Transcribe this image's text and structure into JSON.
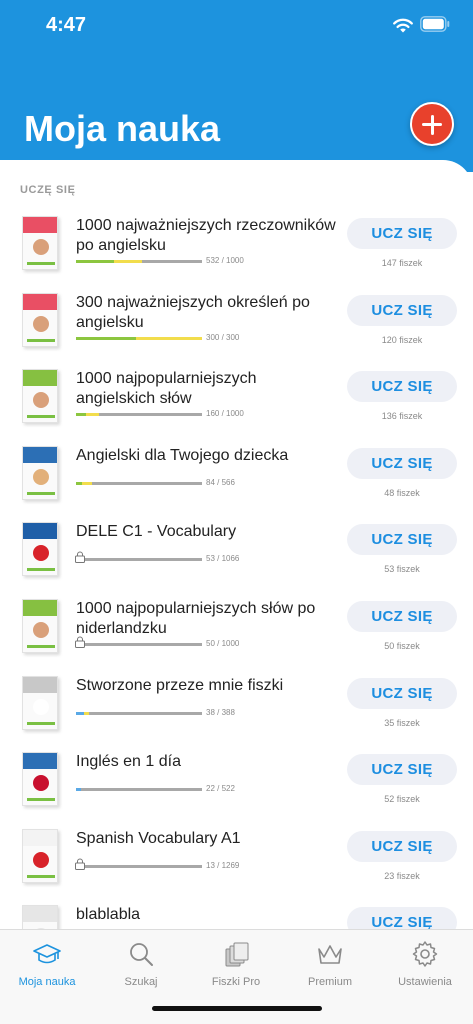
{
  "status": {
    "time": "4:47"
  },
  "header": {
    "title": "Moja nauka",
    "add_icon": "plus-icon"
  },
  "section": {
    "label": "UCZĘ SIĘ"
  },
  "colors": {
    "accent": "#1d93de",
    "add_button": "#e8412c",
    "progress_green": "#8cc63f",
    "progress_yellow": "#f2dd4c",
    "progress_blue": "#5aa9e6"
  },
  "courses": [
    {
      "title": "1000 najważniejszych rzeczowników po angielsku",
      "count": "532 / 1000",
      "fiszki": "147 fiszek",
      "button": "UCZ SIĘ",
      "green": 0.3,
      "yellow": 0.22,
      "blue": 0,
      "locked": false,
      "cover_color": "#e94f64",
      "face_color": "#d9a07a"
    },
    {
      "title": "300 najważniejszych określeń po angielsku",
      "count": "300 / 300",
      "fiszki": "120 fiszek",
      "button": "UCZ SIĘ",
      "green": 0.48,
      "yellow": 0.52,
      "blue": 0,
      "locked": false,
      "cover_color": "#e94f64",
      "face_color": "#d9a07a"
    },
    {
      "title": "1000 najpopularniejszych angielskich słów",
      "count": "160 / 1000",
      "fiszki": "136 fiszek",
      "button": "UCZ SIĘ",
      "green": 0.08,
      "yellow": 0.1,
      "blue": 0,
      "locked": false,
      "cover_color": "#86c041",
      "face_color": "#d9a07a"
    },
    {
      "title": "Angielski dla Twojego dziecka",
      "count": "84 / 566",
      "fiszki": "48 fiszek",
      "button": "UCZ SIĘ",
      "green": 0.05,
      "yellow": 0.08,
      "blue": 0,
      "locked": false,
      "cover_color": "#2c6fb5",
      "face_color": "#e2b07a"
    },
    {
      "title": "DELE C1 - Vocabulary",
      "count": "53 / 1066",
      "fiszki": "53 fiszek",
      "button": "UCZ SIĘ",
      "green": 0,
      "yellow": 0,
      "blue": 0,
      "locked": true,
      "cover_color": "#1f5fa8",
      "face_color": "#d8232a"
    },
    {
      "title": "1000 najpopularniejszych słów po niderlandzku",
      "count": "50 / 1000",
      "fiszki": "50 fiszek",
      "button": "UCZ SIĘ",
      "green": 0,
      "yellow": 0,
      "blue": 0,
      "locked": true,
      "cover_color": "#86c041",
      "face_color": "#d9a07a"
    },
    {
      "title": "Stworzone przeze mnie fiszki",
      "count": "38 / 388",
      "fiszki": "35 fiszek",
      "button": "UCZ SIĘ",
      "green": 0,
      "yellow": 0.04,
      "blue": 0.06,
      "locked": false,
      "cover_color": "#c8c8c8",
      "face_color": "#ffffff"
    },
    {
      "title": "Inglés en 1 día",
      "count": "22 / 522",
      "fiszki": "52 fiszek",
      "button": "UCZ SIĘ",
      "green": 0,
      "yellow": 0,
      "blue": 0.04,
      "locked": false,
      "cover_color": "#2c6fb5",
      "face_color": "#c8102e"
    },
    {
      "title": "Spanish Vocabulary A1",
      "count": "13 / 1269",
      "fiszki": "23 fiszek",
      "button": "UCZ SIĘ",
      "green": 0,
      "yellow": 0,
      "blue": 0,
      "locked": true,
      "cover_color": "#f3f3f3",
      "face_color": "#d8232a"
    },
    {
      "title": "blablabla",
      "count": "",
      "fiszki": "",
      "button": "UCZ SIĘ",
      "green": 0,
      "yellow": 0,
      "blue": 0,
      "locked": false,
      "cover_color": "#e6e6e6",
      "face_color": "#e6e6e6"
    }
  ],
  "tabs": [
    {
      "label": "Moja nauka",
      "icon": "graduation-cap-icon",
      "active": true
    },
    {
      "label": "Szukaj",
      "icon": "search-icon",
      "active": false
    },
    {
      "label": "Fiszki Pro",
      "icon": "flashcards-icon",
      "active": false
    },
    {
      "label": "Premium",
      "icon": "crown-icon",
      "active": false
    },
    {
      "label": "Ustawienia",
      "icon": "gear-icon",
      "active": false
    }
  ]
}
